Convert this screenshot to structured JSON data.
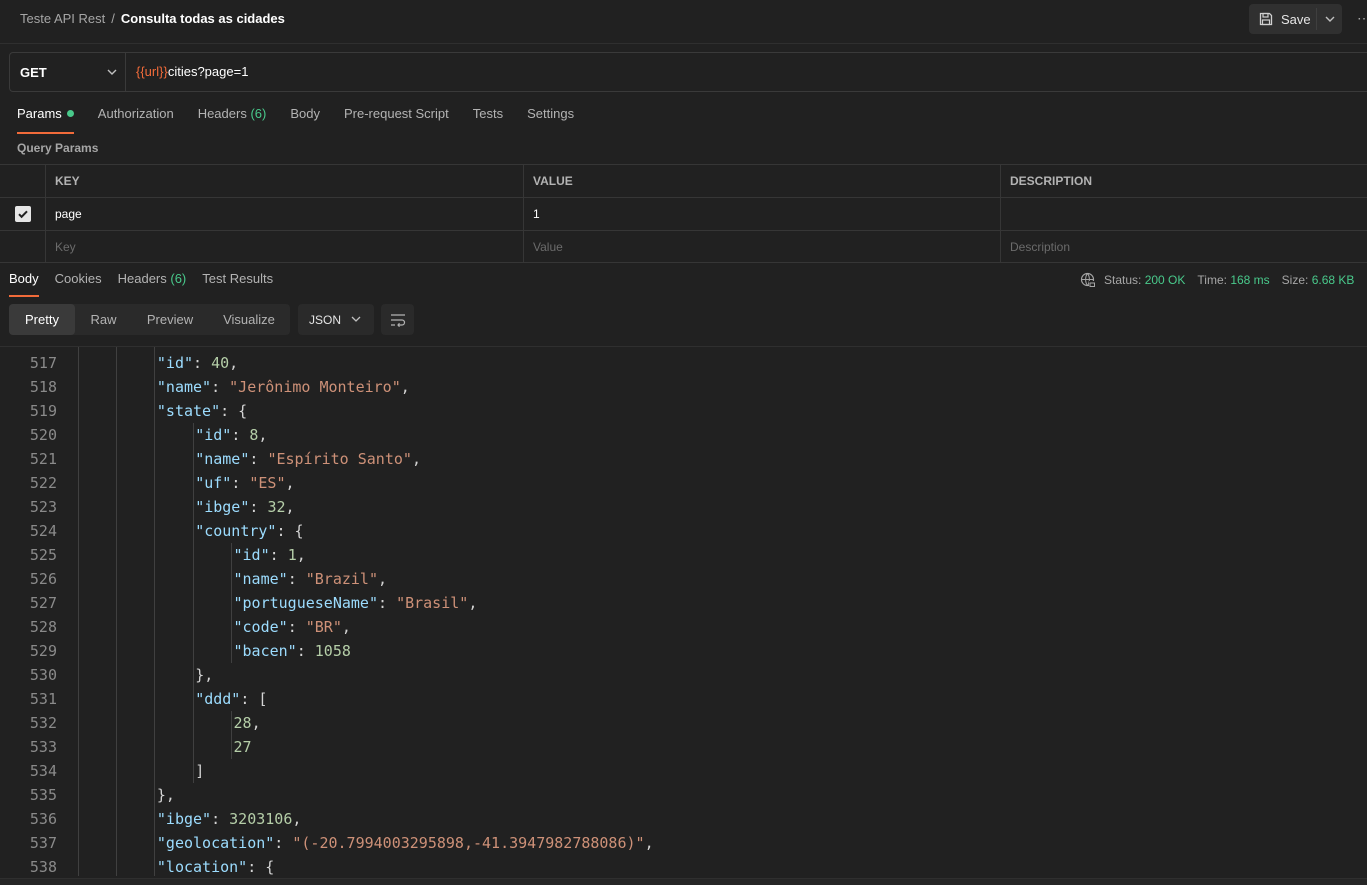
{
  "breadcrumb": {
    "collection": "Teste API Rest",
    "separator": "/",
    "request": "Consulta todas as cidades"
  },
  "header": {
    "save_label": "Save",
    "more_label": "⋯"
  },
  "request": {
    "method": "GET",
    "url_variable": "{{url}}",
    "url_rest": "cities?page=1",
    "tabs": [
      {
        "label": "Params",
        "active": true
      },
      {
        "label": "Authorization"
      },
      {
        "label": "Headers",
        "count": "(6)"
      },
      {
        "label": "Body"
      },
      {
        "label": "Pre-request Script"
      },
      {
        "label": "Tests"
      },
      {
        "label": "Settings"
      }
    ]
  },
  "query_params": {
    "title": "Query Params",
    "headers": [
      "KEY",
      "VALUE",
      "DESCRIPTION"
    ],
    "rows": [
      {
        "checked": true,
        "key": "page",
        "value": "1",
        "description": ""
      }
    ],
    "placeholders": {
      "key": "Key",
      "value": "Value",
      "description": "Description"
    }
  },
  "response": {
    "tabs": [
      {
        "label": "Body",
        "active": true
      },
      {
        "label": "Cookies"
      },
      {
        "label": "Headers",
        "count": "(6)"
      },
      {
        "label": "Test Results"
      }
    ],
    "status_label": "Status:",
    "status_value": "200 OK",
    "time_label": "Time:",
    "time_value": "168 ms",
    "size_label": "Size:",
    "size_value": "6.68 KB",
    "views": [
      "Pretty",
      "Raw",
      "Preview",
      "Visualize"
    ],
    "active_view": "Pretty",
    "format": "JSON"
  },
  "code_lines": [
    {
      "n": "517",
      "indent": 3,
      "tokens": [
        [
          "key",
          "\"id\""
        ],
        [
          "pun",
          ": "
        ],
        [
          "num",
          "40"
        ],
        [
          "pun",
          ","
        ]
      ]
    },
    {
      "n": "518",
      "indent": 3,
      "tokens": [
        [
          "key",
          "\"name\""
        ],
        [
          "pun",
          ": "
        ],
        [
          "str",
          "\"Jerônimo Monteiro\""
        ],
        [
          "pun",
          ","
        ]
      ]
    },
    {
      "n": "519",
      "indent": 3,
      "tokens": [
        [
          "key",
          "\"state\""
        ],
        [
          "pun",
          ": {"
        ]
      ]
    },
    {
      "n": "520",
      "indent": 4,
      "tokens": [
        [
          "key",
          "\"id\""
        ],
        [
          "pun",
          ": "
        ],
        [
          "num",
          "8"
        ],
        [
          "pun",
          ","
        ]
      ]
    },
    {
      "n": "521",
      "indent": 4,
      "tokens": [
        [
          "key",
          "\"name\""
        ],
        [
          "pun",
          ": "
        ],
        [
          "str",
          "\"Espírito Santo\""
        ],
        [
          "pun",
          ","
        ]
      ]
    },
    {
      "n": "522",
      "indent": 4,
      "tokens": [
        [
          "key",
          "\"uf\""
        ],
        [
          "pun",
          ": "
        ],
        [
          "str",
          "\"ES\""
        ],
        [
          "pun",
          ","
        ]
      ]
    },
    {
      "n": "523",
      "indent": 4,
      "tokens": [
        [
          "key",
          "\"ibge\""
        ],
        [
          "pun",
          ": "
        ],
        [
          "num",
          "32"
        ],
        [
          "pun",
          ","
        ]
      ]
    },
    {
      "n": "524",
      "indent": 4,
      "tokens": [
        [
          "key",
          "\"country\""
        ],
        [
          "pun",
          ": {"
        ]
      ]
    },
    {
      "n": "525",
      "indent": 5,
      "tokens": [
        [
          "key",
          "\"id\""
        ],
        [
          "pun",
          ": "
        ],
        [
          "num",
          "1"
        ],
        [
          "pun",
          ","
        ]
      ]
    },
    {
      "n": "526",
      "indent": 5,
      "tokens": [
        [
          "key",
          "\"name\""
        ],
        [
          "pun",
          ": "
        ],
        [
          "str",
          "\"Brazil\""
        ],
        [
          "pun",
          ","
        ]
      ]
    },
    {
      "n": "527",
      "indent": 5,
      "tokens": [
        [
          "key",
          "\"portugueseName\""
        ],
        [
          "pun",
          ": "
        ],
        [
          "str",
          "\"Brasil\""
        ],
        [
          "pun",
          ","
        ]
      ]
    },
    {
      "n": "528",
      "indent": 5,
      "tokens": [
        [
          "key",
          "\"code\""
        ],
        [
          "pun",
          ": "
        ],
        [
          "str",
          "\"BR\""
        ],
        [
          "pun",
          ","
        ]
      ]
    },
    {
      "n": "529",
      "indent": 5,
      "tokens": [
        [
          "key",
          "\"bacen\""
        ],
        [
          "pun",
          ": "
        ],
        [
          "num",
          "1058"
        ]
      ]
    },
    {
      "n": "530",
      "indent": 4,
      "tokens": [
        [
          "pun",
          "},"
        ]
      ]
    },
    {
      "n": "531",
      "indent": 4,
      "tokens": [
        [
          "key",
          "\"ddd\""
        ],
        [
          "pun",
          ": ["
        ]
      ]
    },
    {
      "n": "532",
      "indent": 5,
      "tokens": [
        [
          "num",
          "28"
        ],
        [
          "pun",
          ","
        ]
      ]
    },
    {
      "n": "533",
      "indent": 5,
      "tokens": [
        [
          "num",
          "27"
        ]
      ]
    },
    {
      "n": "534",
      "indent": 4,
      "tokens": [
        [
          "pun",
          "]"
        ]
      ]
    },
    {
      "n": "535",
      "indent": 3,
      "tokens": [
        [
          "pun",
          "},"
        ]
      ]
    },
    {
      "n": "536",
      "indent": 3,
      "tokens": [
        [
          "key",
          "\"ibge\""
        ],
        [
          "pun",
          ": "
        ],
        [
          "num",
          "3203106"
        ],
        [
          "pun",
          ","
        ]
      ]
    },
    {
      "n": "537",
      "indent": 3,
      "tokens": [
        [
          "key",
          "\"geolocation\""
        ],
        [
          "pun",
          ": "
        ],
        [
          "str",
          "\"(-20.7994003295898,-41.3947982788086)\""
        ],
        [
          "pun",
          ","
        ]
      ]
    },
    {
      "n": "538",
      "indent": 3,
      "tokens": [
        [
          "key",
          "\"location\""
        ],
        [
          "pun",
          ": {"
        ]
      ]
    }
  ]
}
